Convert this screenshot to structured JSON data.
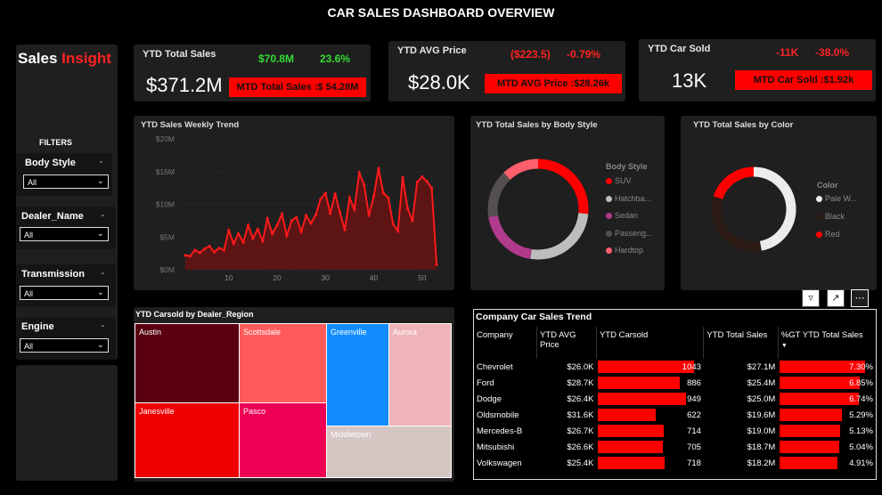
{
  "header": {
    "title": "CAR SALES DASHBOARD OVERVIEW"
  },
  "sidebar": {
    "logo_part1": "Sales ",
    "logo_part2": "Insight",
    "filters_heading": "FILTERS",
    "filters": [
      {
        "title": "Body Style",
        "value": "All"
      },
      {
        "title": "Dealer_Name",
        "value": "All"
      },
      {
        "title": "Transmission",
        "value": "All"
      },
      {
        "title": "Engine",
        "value": "All"
      }
    ]
  },
  "kpis": [
    {
      "label": "YTD Total Sales",
      "value": "$371.2M",
      "delta": "$70.8M",
      "delta_pct": "23.6%",
      "mtd": "MTD Total Sales :$ 54.28M",
      "delta_color": "#33dd33"
    },
    {
      "label": "YTD AVG Price",
      "value": "$28.0K",
      "delta": "($223.5)",
      "delta_pct": "-0.79%",
      "mtd": "MTD AVG Price :$28.26k",
      "delta_color": "#ff2222"
    },
    {
      "label": "YTD Car Sold",
      "value": "13K",
      "delta": "-11K",
      "delta_pct": "-38.0%",
      "mtd": "MTD Car Sold :$1.92k",
      "delta_color": "#ff2222"
    }
  ],
  "colors": {
    "accent": "#ff0000",
    "card": "#1f1f1f",
    "background": "#000000"
  },
  "weekly_trend": {
    "title": "YTD Sales Weekly Trend",
    "y_ticks": [
      "$20M",
      "$15M",
      "$10M",
      "$5M",
      "$0M"
    ],
    "x_ticks": [
      "10",
      "20",
      "30",
      "40",
      "50"
    ]
  },
  "body_style": {
    "title": "YTD Total Sales by Body Style",
    "legend_title": "Body Style",
    "items": [
      {
        "label": "SUV",
        "color": "#ff0000"
      },
      {
        "label": "Hatchba...",
        "color": "#bdbdbd"
      },
      {
        "label": "Sedan",
        "color": "#b03a8c"
      },
      {
        "label": "Passeng...",
        "color": "#555050"
      },
      {
        "label": "Hardtop",
        "color": "#ff5f6d"
      }
    ]
  },
  "by_color": {
    "title": "YTD Total Sales by Color",
    "legend_title": "Color",
    "items": [
      {
        "label": "Pale W...",
        "color": "#ececec"
      },
      {
        "label": "Black",
        "color": "#2b1a14"
      },
      {
        "label": "Red",
        "color": "#ff0000"
      }
    ]
  },
  "treemap": {
    "title": "YTD Carsold by Dealer_Region",
    "regions": [
      "Austin",
      "Scottsdale",
      "Greenville",
      "Aurora",
      "Janesville",
      "Pasco",
      "Middletown"
    ]
  },
  "company_table": {
    "title": "Company Car Sales Trend",
    "columns": [
      "Company",
      "YTD AVG Price",
      "YTD Carsold",
      "YTD Total Sales",
      "%GT YTD Total Sales"
    ],
    "sort_glyph": "▼",
    "rows": [
      {
        "company": "Chevrolet",
        "avg": "$26.0K",
        "sold": "1043",
        "total": "$27.1M",
        "pct": "7.30%"
      },
      {
        "company": "Ford",
        "avg": "$28.7K",
        "sold": "886",
        "total": "$25.4M",
        "pct": "6.85%"
      },
      {
        "company": "Dodge",
        "avg": "$26.4K",
        "sold": "949",
        "total": "$25.0M",
        "pct": "6.74%"
      },
      {
        "company": "Oldsmobile",
        "avg": "$31.6K",
        "sold": "622",
        "total": "$19.6M",
        "pct": "5.29%"
      },
      {
        "company": "Mercedes-B",
        "avg": "$26.7K",
        "sold": "714",
        "total": "$19.0M",
        "pct": "5.13%"
      },
      {
        "company": "Mitsubishi",
        "avg": "$26.6K",
        "sold": "705",
        "total": "$18.7M",
        "pct": "5.04%"
      },
      {
        "company": "Volkswagen",
        "avg": "$25.4K",
        "sold": "718",
        "total": "$18.2M",
        "pct": "4.91%"
      }
    ]
  },
  "chart_data": [
    {
      "type": "area",
      "title": "YTD Sales Weekly Trend",
      "xlabel": "",
      "ylabel": "",
      "x": [
        1,
        2,
        3,
        4,
        5,
        6,
        7,
        8,
        9,
        10,
        11,
        12,
        13,
        14,
        15,
        16,
        17,
        18,
        19,
        20,
        21,
        22,
        23,
        24,
        25,
        26,
        27,
        28,
        29,
        30,
        31,
        32,
        33,
        34,
        35,
        36,
        37,
        38,
        39,
        40,
        41,
        42,
        43,
        44,
        45,
        46,
        47,
        48,
        49,
        50,
        51,
        52,
        53
      ],
      "values": [
        2.2,
        2.1,
        3.0,
        2.6,
        3.2,
        3.6,
        2.7,
        3.3,
        3.0,
        6.0,
        4.0,
        5.5,
        4.2,
        6.8,
        4.8,
        6.2,
        4.4,
        7.8,
        5.5,
        6.8,
        8.5,
        5.2,
        7.5,
        8.0,
        5.8,
        8.3,
        7.1,
        8.4,
        10.8,
        11.7,
        8.6,
        11.6,
        8.8,
        6.1,
        11.0,
        9.2,
        14.8,
        13.0,
        8.3,
        11.2,
        15.5,
        11.7,
        11.0,
        7.0,
        5.9,
        14.1,
        9.4,
        7.5,
        13.4,
        14.2,
        13.5,
        12.5,
        0.8
      ],
      "ylim": [
        0,
        20
      ],
      "y_ticks": [
        "$20M",
        "$15M",
        "$10M",
        "$5M",
        "$0M"
      ],
      "x_ticks": [
        10,
        20,
        30,
        40,
        50
      ],
      "grid": true
    },
    {
      "type": "pie",
      "title": "YTD Total Sales by Body Style",
      "categories": [
        "SUV",
        "Hatchback",
        "Sedan",
        "Passenger",
        "Hardtop"
      ],
      "values": [
        26.5,
        26,
        20,
        15.5,
        12
      ],
      "donut": true
    },
    {
      "type": "pie",
      "title": "YTD Total Sales by Color",
      "categories": [
        "Pale White",
        "Black",
        "Red"
      ],
      "values": [
        47,
        33,
        20
      ],
      "donut": true
    },
    {
      "type": "table",
      "title": "Company Car Sales Trend",
      "categories": [
        "Chevrolet",
        "Ford",
        "Dodge",
        "Oldsmobile",
        "Mercedes-B",
        "Mitsubishi",
        "Volkswagen"
      ],
      "series": [
        {
          "name": "YTD Carsold",
          "values": [
            1043,
            886,
            949,
            622,
            714,
            705,
            718
          ]
        },
        {
          "name": "%GT YTD Total Sales",
          "values": [
            7.3,
            6.85,
            6.74,
            5.29,
            5.13,
            5.04,
            4.91
          ]
        }
      ]
    }
  ]
}
